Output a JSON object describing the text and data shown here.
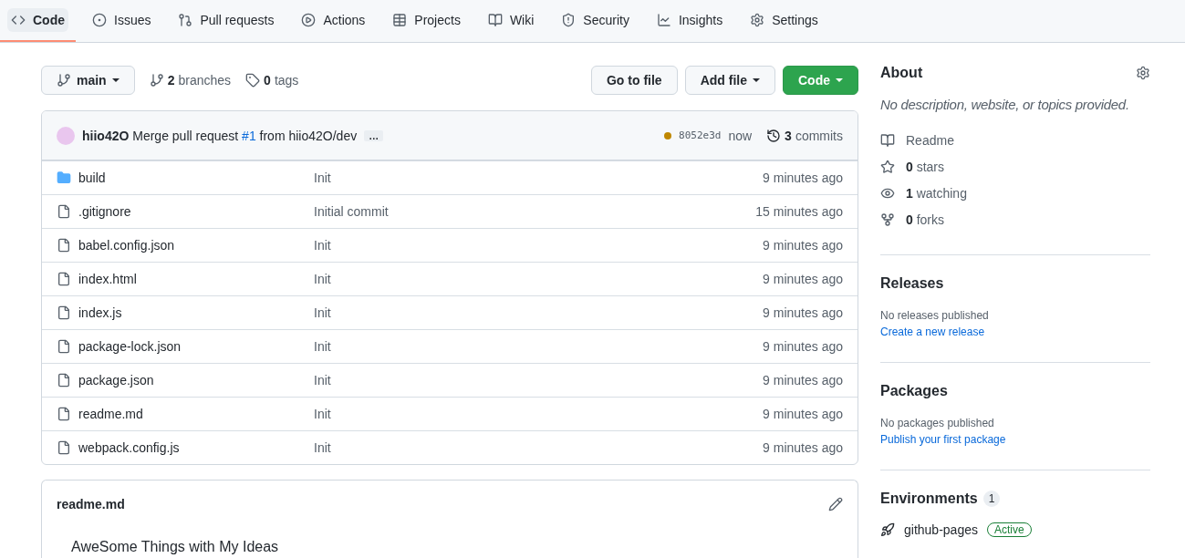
{
  "tabs": [
    {
      "label": "Code",
      "selected": true
    },
    {
      "label": "Issues",
      "selected": false
    },
    {
      "label": "Pull requests",
      "selected": false
    },
    {
      "label": "Actions",
      "selected": false
    },
    {
      "label": "Projects",
      "selected": false
    },
    {
      "label": "Wiki",
      "selected": false
    },
    {
      "label": "Security",
      "selected": false
    },
    {
      "label": "Insights",
      "selected": false
    },
    {
      "label": "Settings",
      "selected": false
    }
  ],
  "branch": {
    "name": "main",
    "branches_count": "2",
    "branches_label": "branches",
    "tags_count": "0",
    "tags_label": "tags"
  },
  "actions": {
    "go_to_file": "Go to file",
    "add_file": "Add file",
    "code": "Code"
  },
  "commit": {
    "author": "hiio42O",
    "message_before": "Merge pull request",
    "pr_link": "#1",
    "message_after": "from hiio42O/dev",
    "ellipsis": "…",
    "sha": "8052e3d",
    "time": "now",
    "commits_count": "3",
    "commits_label": "commits"
  },
  "files": [
    {
      "kind": "dir",
      "name": "build",
      "message": "Init",
      "time": "9 minutes ago"
    },
    {
      "kind": "file",
      "name": ".gitignore",
      "message": "Initial commit",
      "time": "15 minutes ago"
    },
    {
      "kind": "file",
      "name": "babel.config.json",
      "message": "Init",
      "time": "9 minutes ago"
    },
    {
      "kind": "file",
      "name": "index.html",
      "message": "Init",
      "time": "9 minutes ago"
    },
    {
      "kind": "file",
      "name": "index.js",
      "message": "Init",
      "time": "9 minutes ago"
    },
    {
      "kind": "file",
      "name": "package-lock.json",
      "message": "Init",
      "time": "9 minutes ago"
    },
    {
      "kind": "file",
      "name": "package.json",
      "message": "Init",
      "time": "9 minutes ago"
    },
    {
      "kind": "file",
      "name": "readme.md",
      "message": "Init",
      "time": "9 minutes ago"
    },
    {
      "kind": "file",
      "name": "webpack.config.js",
      "message": "Init",
      "time": "9 minutes ago"
    }
  ],
  "readme": {
    "filename": "readme.md",
    "content": "AweSome Things with My Ideas"
  },
  "about": {
    "title": "About",
    "description": "No description, website, or topics provided.",
    "stats": [
      {
        "label": "Readme"
      },
      {
        "count": "0",
        "label": "stars"
      },
      {
        "count": "1",
        "label": "watching"
      },
      {
        "count": "0",
        "label": "forks"
      }
    ]
  },
  "releases": {
    "title": "Releases",
    "note": "No releases published",
    "link": "Create a new release"
  },
  "packages": {
    "title": "Packages",
    "note": "No packages published",
    "link": "Publish your first package"
  },
  "environments": {
    "title": "Environments",
    "count": "1",
    "items": [
      {
        "name": "github-pages",
        "status": "Active"
      }
    ]
  }
}
